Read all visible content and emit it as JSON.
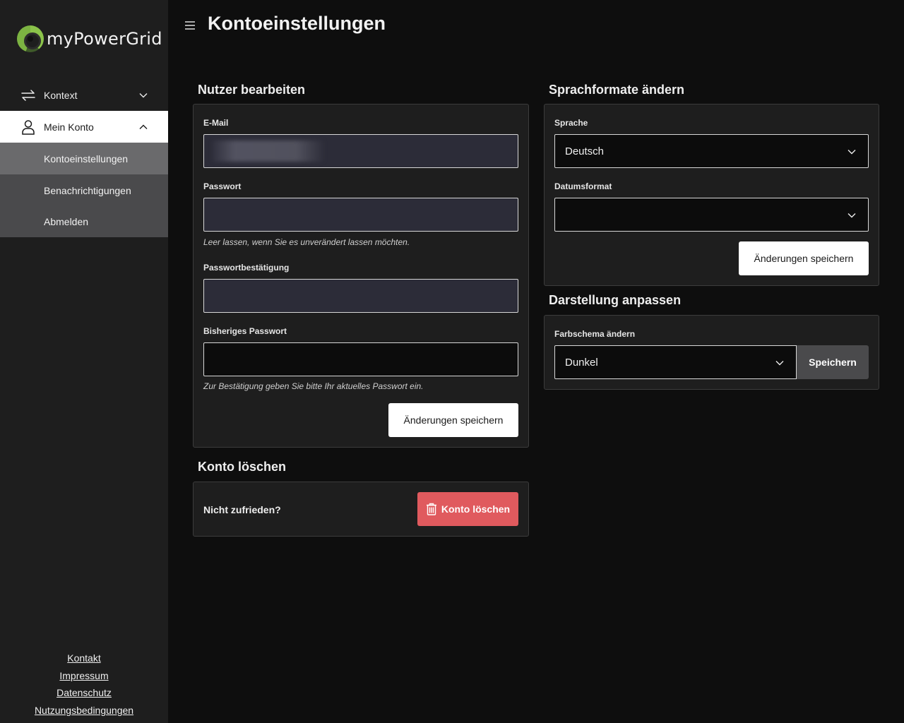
{
  "app": {
    "brand": "myPowerGrid"
  },
  "sidebar": {
    "context_label": "Kontext",
    "account_label": "Mein Konto",
    "sub_items": [
      "Kontoeinstellungen",
      "Benachrichtigungen",
      "Abmelden"
    ],
    "footer_links": [
      "Kontakt",
      "Impressum",
      "Datenschutz",
      "Nutzungsbedingungen"
    ]
  },
  "header": {
    "title": "Kontoeinstellungen"
  },
  "edit_user": {
    "title": "Nutzer bearbeiten",
    "email_label": "E-Mail",
    "email_value": "",
    "password_label": "Passwort",
    "password_hint": "Leer lassen, wenn Sie es unverändert lassen möchten.",
    "password_confirm_label": "Passwortbestätigung",
    "old_password_label": "Bisheriges Passwort",
    "old_password_hint": "Zur Bestätigung geben Sie bitte Ihr aktuelles Passwort ein.",
    "save_label": "Änderungen speichern"
  },
  "delete_account": {
    "title": "Konto löschen",
    "prompt": "Nicht zufrieden?",
    "button_label": "Konto löschen"
  },
  "language": {
    "title": "Sprachformate ändern",
    "language_label": "Sprache",
    "language_value": "Deutsch",
    "date_format_label": "Datumsformat",
    "date_format_value": "",
    "save_label": "Änderungen speichern"
  },
  "appearance": {
    "title": "Darstellung anpassen",
    "scheme_label": "Farbschema ändern",
    "scheme_value": "Dunkel",
    "save_label": "Speichern"
  },
  "colors": {
    "background": "#0e0e0e",
    "sidebar": "#1e1e1e",
    "danger": "#e05a5e",
    "brand_green": "#8bc34a"
  },
  "icons": {
    "context": "swap-arrows-icon",
    "account": "user-icon",
    "menu": "hamburger-icon",
    "delete": "trash-icon",
    "select": "chevron-down-icon"
  }
}
